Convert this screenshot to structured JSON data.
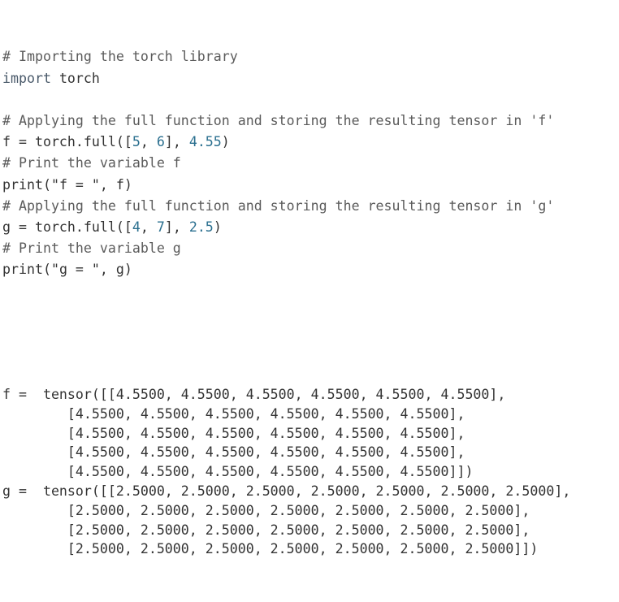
{
  "code_lines": [
    {
      "type": "comment",
      "text": "# Importing the torch library"
    },
    {
      "type": "code",
      "parts": [
        {
          "cls": "kw",
          "text": "import"
        },
        {
          "cls": "fn",
          "text": " torch"
        }
      ]
    },
    {
      "type": "blank"
    },
    {
      "type": "comment",
      "text": "# Applying the full function and storing the resulting tensor in 'f'"
    },
    {
      "type": "code",
      "parts": [
        {
          "cls": "fn",
          "text": "f = torch.full(["
        },
        {
          "cls": "num",
          "text": "5"
        },
        {
          "cls": "fn",
          "text": ", "
        },
        {
          "cls": "num",
          "text": "6"
        },
        {
          "cls": "fn",
          "text": "], "
        },
        {
          "cls": "num",
          "text": "4.55"
        },
        {
          "cls": "fn",
          "text": ")"
        }
      ]
    },
    {
      "type": "comment",
      "text": "# Print the variable f"
    },
    {
      "type": "code",
      "parts": [
        {
          "cls": "fn",
          "text": "print("
        },
        {
          "cls": "str",
          "text": "\"f = \""
        },
        {
          "cls": "fn",
          "text": ", f)"
        }
      ]
    },
    {
      "type": "comment",
      "text": "# Applying the full function and storing the resulting tensor in 'g'"
    },
    {
      "type": "code",
      "parts": [
        {
          "cls": "fn",
          "text": "g = torch.full(["
        },
        {
          "cls": "num",
          "text": "4"
        },
        {
          "cls": "fn",
          "text": ", "
        },
        {
          "cls": "num",
          "text": "7"
        },
        {
          "cls": "fn",
          "text": "], "
        },
        {
          "cls": "num",
          "text": "2.5"
        },
        {
          "cls": "fn",
          "text": ")"
        }
      ]
    },
    {
      "type": "comment",
      "text": "# Print the variable g"
    },
    {
      "type": "code",
      "parts": [
        {
          "cls": "fn",
          "text": "print("
        },
        {
          "cls": "str",
          "text": "\"g = \""
        },
        {
          "cls": "fn",
          "text": ", g)"
        }
      ]
    }
  ],
  "output_lines": [
    "f =  tensor([[4.5500, 4.5500, 4.5500, 4.5500, 4.5500, 4.5500],",
    "        [4.5500, 4.5500, 4.5500, 4.5500, 4.5500, 4.5500],",
    "        [4.5500, 4.5500, 4.5500, 4.5500, 4.5500, 4.5500],",
    "        [4.5500, 4.5500, 4.5500, 4.5500, 4.5500, 4.5500],",
    "        [4.5500, 4.5500, 4.5500, 4.5500, 4.5500, 4.5500]])",
    "g =  tensor([[2.5000, 2.5000, 2.5000, 2.5000, 2.5000, 2.5000, 2.5000],",
    "        [2.5000, 2.5000, 2.5000, 2.5000, 2.5000, 2.5000, 2.5000],",
    "        [2.5000, 2.5000, 2.5000, 2.5000, 2.5000, 2.5000, 2.5000],",
    "        [2.5000, 2.5000, 2.5000, 2.5000, 2.5000, 2.5000, 2.5000]])"
  ]
}
